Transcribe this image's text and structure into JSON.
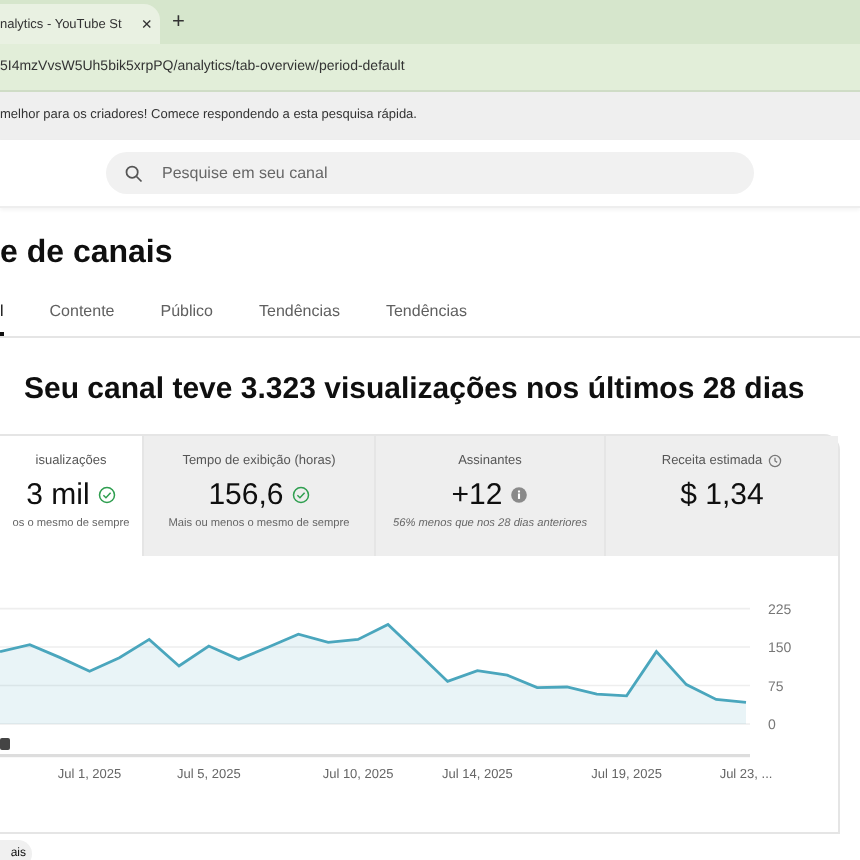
{
  "browser": {
    "tab_title": "nalytics - YouTube St",
    "close": "×",
    "new_tab": "+",
    "url": "5I4mzVvsW5Uh5bik5xrpPQ/analytics/tab-overview/period-default"
  },
  "notice": "melhor para os criadores! Comece respondendo a esta pesquisa rápida.",
  "search": {
    "placeholder": "Pesquise em seu canal"
  },
  "page_title": "e de canais",
  "tabs": [
    {
      "label": "l",
      "selected": true
    },
    {
      "label": "Contente",
      "selected": false
    },
    {
      "label": "Público",
      "selected": false
    },
    {
      "label": "Tendências",
      "selected": false
    },
    {
      "label": "Tendências",
      "selected": false
    }
  ],
  "headline": "Seu canal teve 3.323 visualizações nos últimos 28 dias",
  "cards": [
    {
      "kind": "check",
      "label": "isualizações",
      "value": "3 mil",
      "note": "os o mesmo de sempre",
      "selected": true
    },
    {
      "kind": "check",
      "label": "Tempo de exibição (horas)",
      "value": "156,6",
      "note": "Mais ou menos o mesmo de sempre",
      "selected": false
    },
    {
      "kind": "info",
      "label": "Assinantes",
      "value": "+12",
      "note": "56% menos que nos 28 dias anteriores",
      "selected": false
    },
    {
      "kind": "clock",
      "label": "Receita estimada",
      "value": "$ 1,34",
      "selected": false
    }
  ],
  "chart_data": {
    "type": "area",
    "categories": [
      null,
      null,
      null,
      "Jul 1, 2025",
      null,
      null,
      null,
      "Jul 5, 2025",
      null,
      null,
      null,
      null,
      "Jul 10, 2025",
      null,
      null,
      null,
      "Jul 14, 2025",
      null,
      null,
      null,
      null,
      "Jul 19, 2025",
      null,
      null,
      null,
      "Jul 23, ..."
    ],
    "series": [
      {
        "color": "#4aa6bd",
        "values": [
          141,
          155,
          130,
          103,
          129,
          165,
          113,
          152,
          126,
          150,
          175,
          159,
          165,
          194,
          139,
          83,
          104,
          95,
          71,
          72,
          58,
          55,
          141,
          77,
          48,
          42
        ]
      }
    ],
    "ylim": [
      0,
      225
    ],
    "yticks": [
      0,
      75,
      150,
      225
    ]
  },
  "chip": "ais"
}
